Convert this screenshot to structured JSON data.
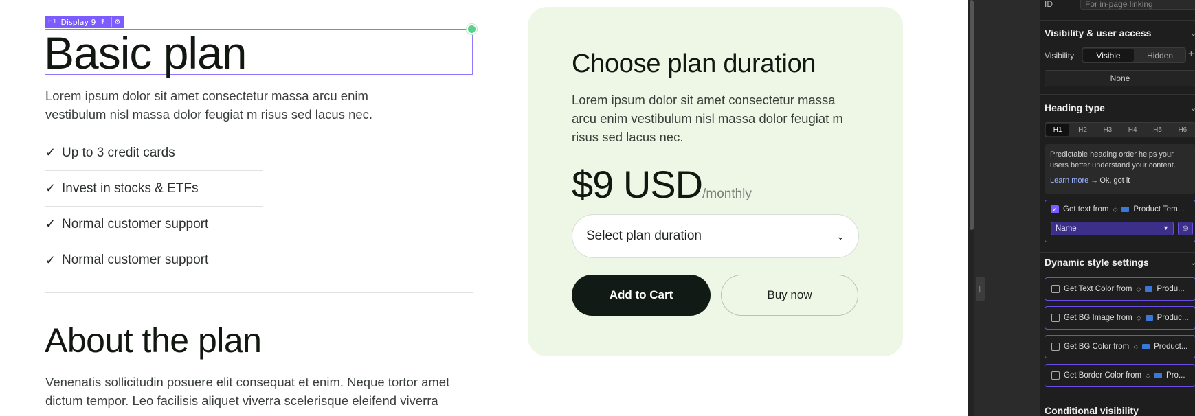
{
  "canvas": {
    "selection_badge": {
      "tag": "H1",
      "label": "Display 9"
    },
    "heading": "Basic plan",
    "intro": "Lorem ipsum dolor sit amet consectetur massa arcu enim vestibulum nisl massa dolor feugiat m risus sed lacus nec.",
    "features": [
      "Up to 3 credit cards",
      "Invest in stocks & ETFs",
      "Normal customer support",
      "Normal customer support"
    ],
    "about_heading": "About the plan",
    "about_body": "Venenatis sollicitudin posuere elit consequat et enim. Neque tortor amet dictum tempor. Leo facilisis aliquet viverra scelerisque eleifend viverra"
  },
  "card": {
    "title": "Choose plan duration",
    "description": "Lorem ipsum dolor sit amet consectetur massa arcu enim vestibulum nisl massa dolor feugiat m risus sed lacus nec.",
    "price": "$9 USD",
    "period": "/monthly",
    "select_label": "Select plan duration",
    "add_to_cart": "Add to Cart",
    "buy_now": "Buy now"
  },
  "panel": {
    "id_label": "ID",
    "id_placeholder": "For in-page linking",
    "visibility_section": "Visibility & user access",
    "visibility_label": "Visibility",
    "visible": "Visible",
    "hidden": "Hidden",
    "none": "None",
    "heading_type_section": "Heading type",
    "heading_levels": [
      "H1",
      "H2",
      "H3",
      "H4",
      "H5",
      "H6"
    ],
    "note_text": "Predictable heading order helps your users better understand your content.",
    "learn_more": "Learn more →",
    "ok_got_it": "Ok, got it",
    "get_text_from": "Get text from",
    "get_text_source": "Product Tem...",
    "field_name": "Name",
    "dynamic_section": "Dynamic style settings",
    "style_items": [
      {
        "label": "Get Text Color from",
        "source": "Produ..."
      },
      {
        "label": "Get BG Image from",
        "source": "Produc..."
      },
      {
        "label": "Get BG Color from",
        "source": "Product..."
      },
      {
        "label": "Get Border Color from",
        "source": "Pro..."
      }
    ],
    "conditional_section": "Conditional visibility"
  },
  "colors": {
    "accent": "#7c5cff",
    "card_bg": "#eef7e6",
    "cart_button": "#111a14",
    "panel_bg": "#1e1e1e"
  }
}
